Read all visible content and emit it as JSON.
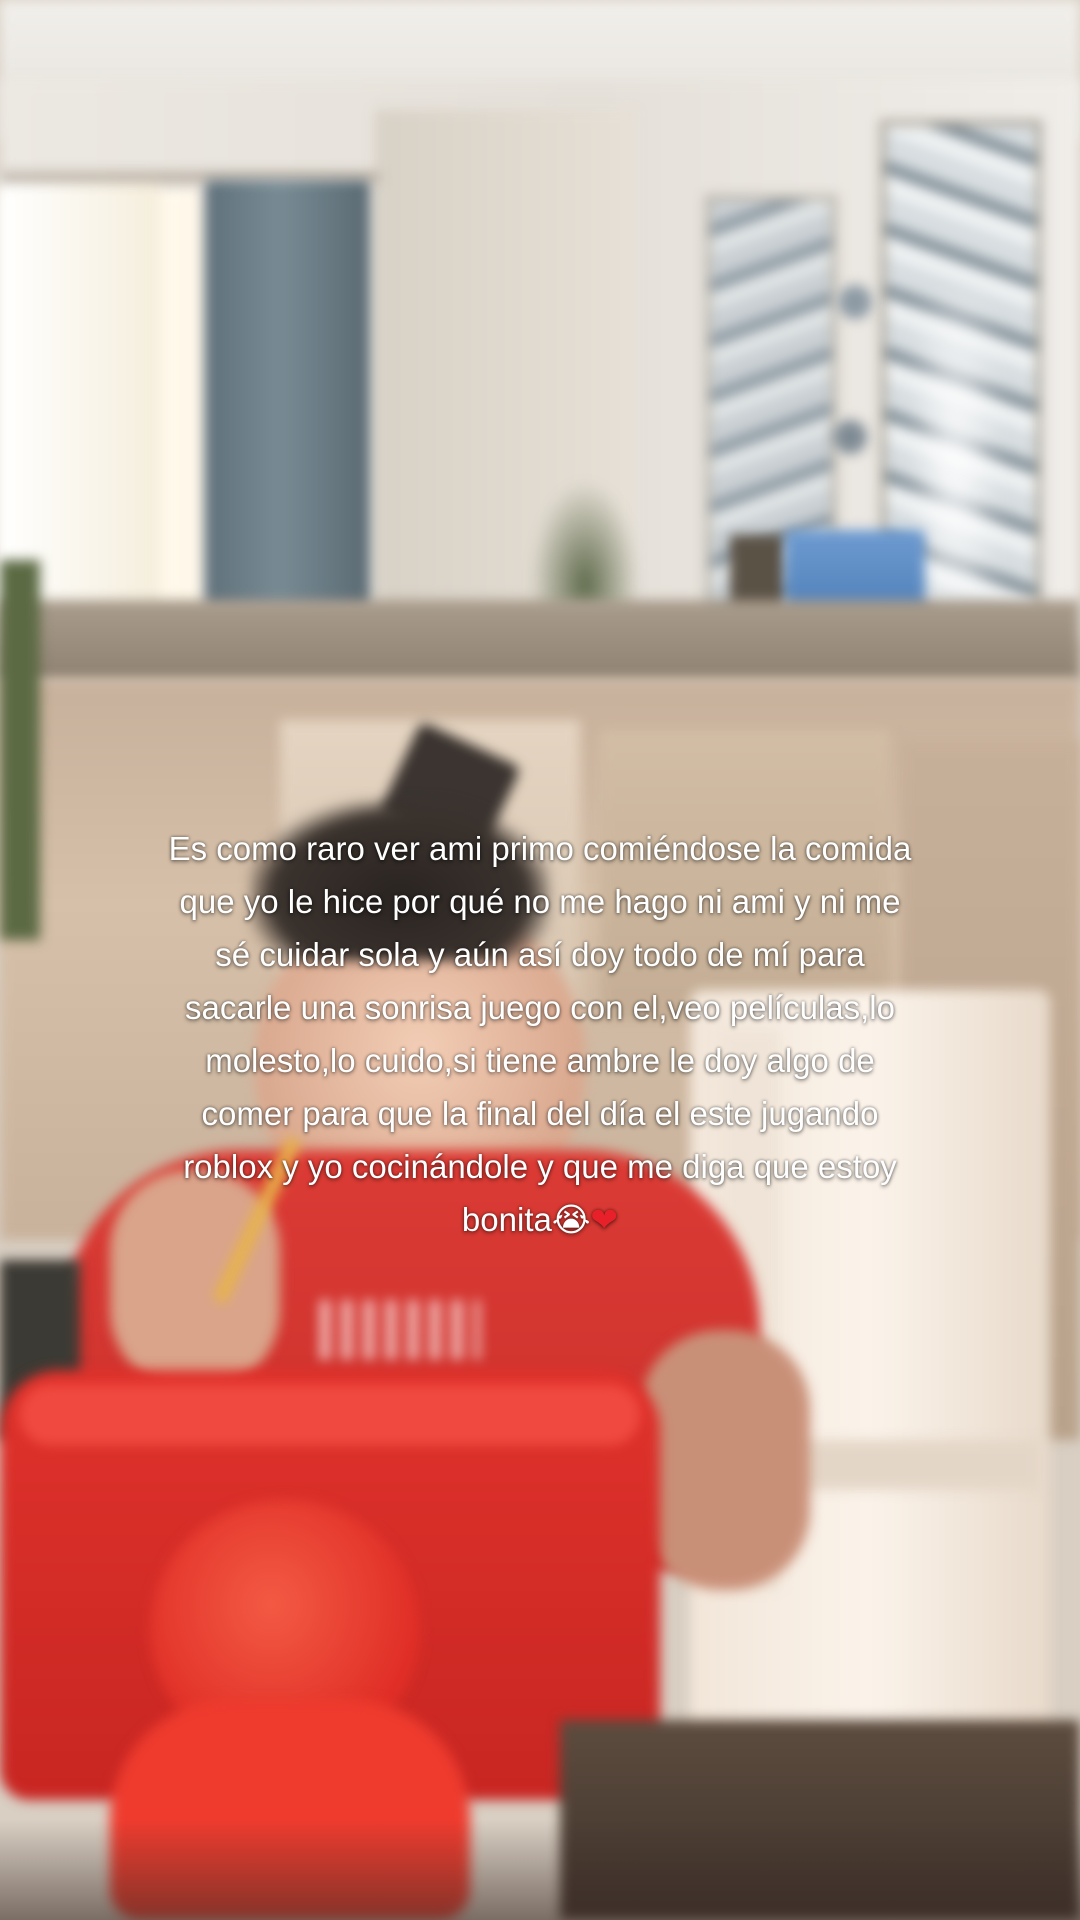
{
  "caption": {
    "lines": [
      "Es como raro ver ami primo comiéndose la comida",
      "que yo le hice por qué no me hago ni ami y ni me",
      "sé cuidar sola y aún así doy todo de mí para",
      "sacarle una sonrisa juego con el,veo películas,lo",
      "molesto,lo cuido,si tiene ambre le doy algo de",
      "comer para que la final del día el este jugando",
      "roblox y yo cocinándole y que me diga que estoy",
      "bonita"
    ],
    "emoji_crying": "😭",
    "emoji_heart": "❤"
  },
  "colors": {
    "caption_text": "#ffffff",
    "shirt": "#dc3b35",
    "tablet_case": "#e0322c",
    "curtain": "#6b7c85"
  }
}
